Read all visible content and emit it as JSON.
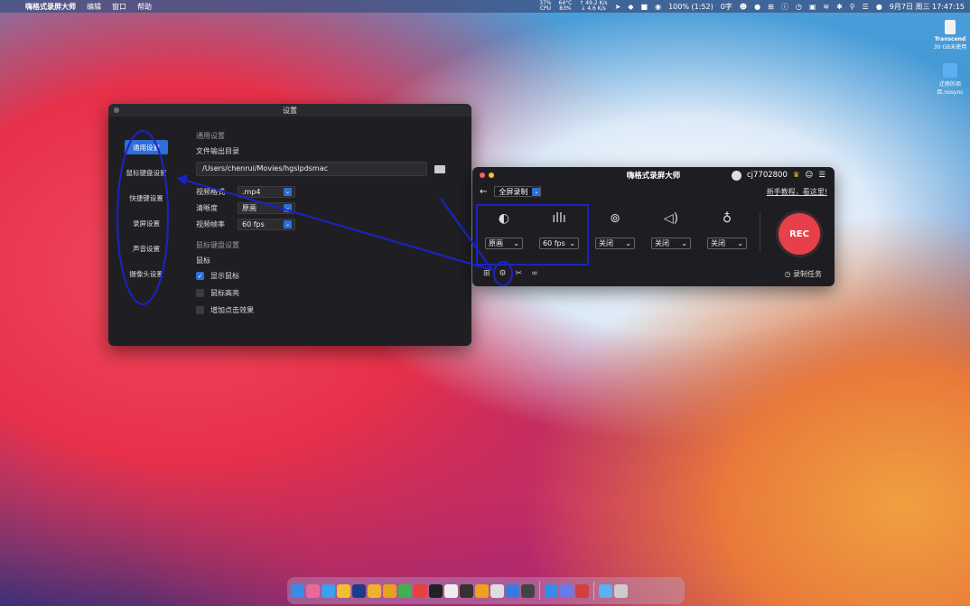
{
  "menubar": {
    "app_name": "嗨格式录屏大师",
    "menus": [
      "编辑",
      "窗口",
      "帮助"
    ],
    "cpu_pct": "37%",
    "cpu_label": "CPU",
    "temp": "64°C",
    "temp_label": "83%",
    "net_up": "↑ 49.2 K/s",
    "net_down": "↓ 4.6 K/s",
    "battery": "100% (1:52)",
    "input_lang": "0字",
    "date_time": "9月7日 周三 17:47:15"
  },
  "desktop": {
    "icons": [
      {
        "label": "Transcend",
        "sublabel": "30 GB未使用"
      },
      {
        "label": "迁移的项",
        "sublabel": "目.nosync"
      }
    ]
  },
  "settings_window": {
    "title": "设置",
    "nav": [
      "通用设置",
      "鼠标键盘设置",
      "快捷键设置",
      "录屏设置",
      "声音设置",
      "摄像头设置"
    ],
    "general_header": "通用设置",
    "output_dir_label": "文件输出目录",
    "output_dir_value": "/Users/chenrui/Movies/hgslpdsmac",
    "video_format_label": "视频格式",
    "video_format_value": ".mp4",
    "quality_label": "清晰度",
    "quality_value": "原画",
    "fps_label": "视频帧率",
    "fps_value": "60 fps",
    "mouse_kb_header": "鼠标键盘设置",
    "mouse_label": "鼠标",
    "show_cursor": "显示鼠标",
    "cursor_highlight": "鼠标高亮",
    "click_effect": "增加点击效果"
  },
  "recorder_window": {
    "title": "嗨格式录屏大师",
    "user_id": "cj7702800",
    "mode": "全屏录制",
    "tutorial_link": "新手教程，看这里!",
    "quality_dd": "原画",
    "fps_dd": "60 fps",
    "camera_dd": "关闭",
    "speaker_dd": "关闭",
    "mic_dd": "关闭",
    "rec_label": "REC",
    "task_label": "录制任务"
  },
  "colors": {
    "accent": "#2e6ed8",
    "rec": "#e8404a",
    "annotation": "#1a23c8"
  }
}
